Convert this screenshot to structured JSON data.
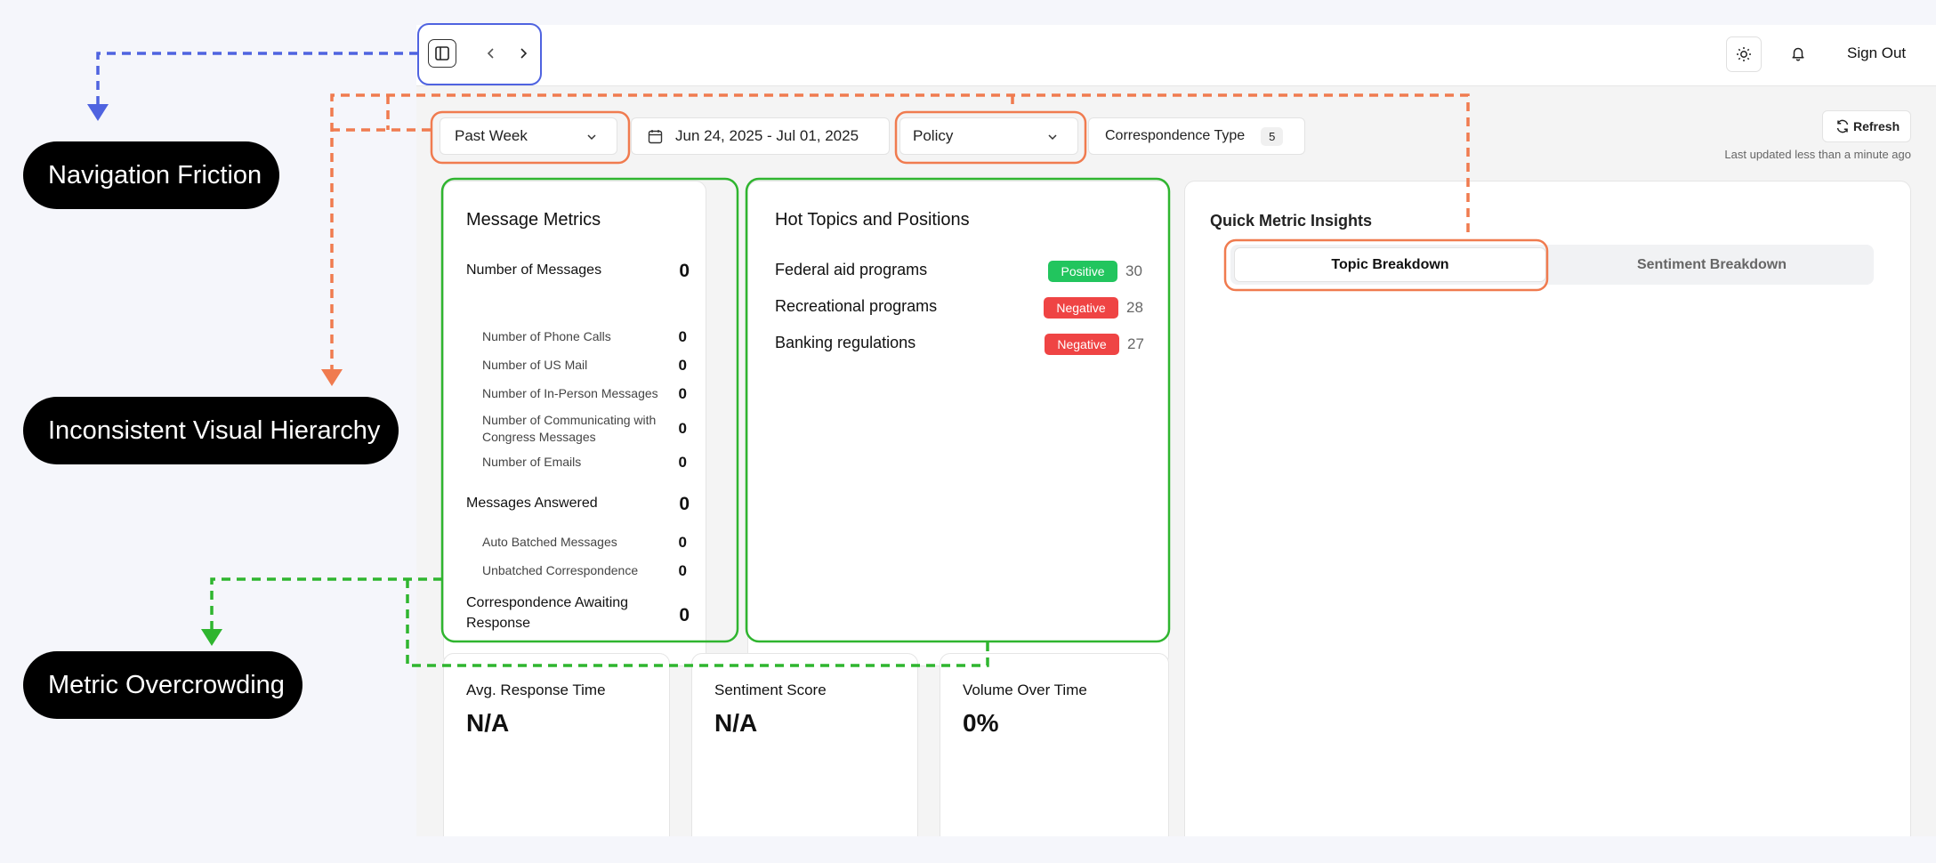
{
  "annotations": {
    "navigation_friction": "Navigation Friction",
    "inconsistent_hierarchy": "Inconsistent Visual Hierarchy",
    "metric_overcrowding": "Metric Overcrowding"
  },
  "topbar": {
    "sidebar_toggle_icon": "sidebar-icon",
    "back_icon": "chevron-left-icon",
    "forward_icon": "chevron-right-icon",
    "theme_icon": "sun-icon",
    "notification_icon": "bell-icon",
    "sign_out_label": "Sign Out"
  },
  "filters": {
    "period": "Past Week",
    "date_range": "Jun 24, 2025 - Jul 01, 2025",
    "category": "Policy",
    "correspondence_type_label": "Correspondence Type",
    "correspondence_type_count": "5",
    "refresh_label": "Refresh",
    "last_updated": "Last updated less than a minute ago"
  },
  "message_metrics": {
    "title": "Message Metrics",
    "number_of_messages_label": "Number of Messages",
    "number_of_messages_value": "0",
    "phone_calls_label": "Number of Phone Calls",
    "phone_calls_value": "0",
    "us_mail_label": "Number of US Mail",
    "us_mail_value": "0",
    "in_person_label": "Number of In-Person Messages",
    "in_person_value": "0",
    "communicating_label_1": "Number of Communicating with",
    "communicating_label_2": "Congress Messages",
    "communicating_value": "0",
    "emails_label": "Number of Emails",
    "emails_value": "0",
    "answered_label": "Messages Answered",
    "answered_value": "0",
    "auto_batched_label": "Auto Batched Messages",
    "auto_batched_value": "0",
    "unbatched_label": "Unbatched Correspondence",
    "unbatched_value": "0",
    "awaiting_label_1": "Correspondence Awaiting",
    "awaiting_label_2": "Response",
    "awaiting_value": "0"
  },
  "hot_topics": {
    "title": "Hot Topics and Positions",
    "items": [
      {
        "topic": "Federal aid programs",
        "sentiment": "Positive",
        "count": "30",
        "color": "#22c55e"
      },
      {
        "topic": "Recreational programs",
        "sentiment": "Negative",
        "count": "28",
        "color": "#ef4444"
      },
      {
        "topic": "Banking regulations",
        "sentiment": "Negative",
        "count": "27",
        "color": "#ef4444"
      }
    ]
  },
  "quick_insights": {
    "title": "Quick Metric Insights",
    "tab_topic": "Topic Breakdown",
    "tab_sentiment": "Sentiment Breakdown"
  },
  "small_metrics": [
    {
      "label": "Avg. Response Time",
      "value": "N/A"
    },
    {
      "label": "Sentiment Score",
      "value": "N/A"
    },
    {
      "label": "Volume Over Time",
      "value": "0%"
    }
  ],
  "colors": {
    "navigation": "#4f63e0",
    "hierarchy": "#f07b4f",
    "overcrowding": "#2fb52f"
  }
}
